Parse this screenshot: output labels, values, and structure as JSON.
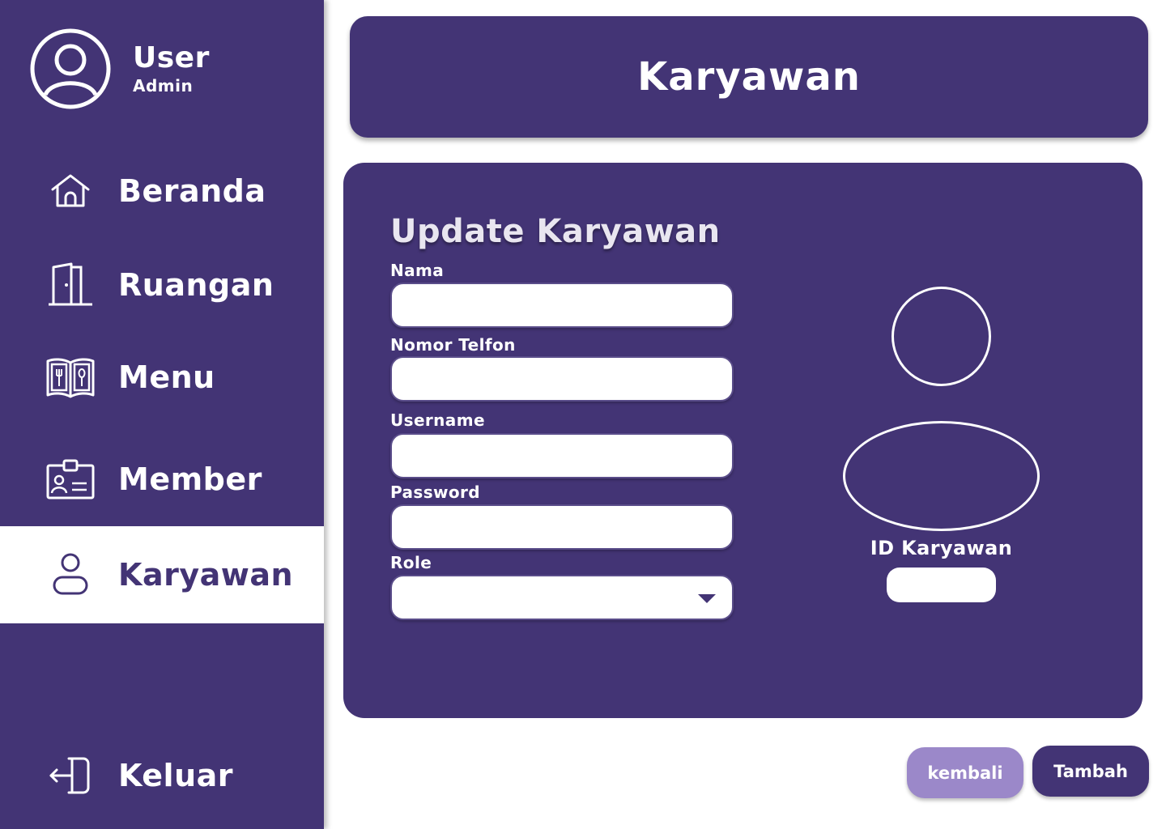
{
  "user": {
    "name": "User",
    "role": "Admin"
  },
  "sidebar": {
    "items": [
      {
        "label": "Beranda",
        "icon": "home-icon"
      },
      {
        "label": "Ruangan",
        "icon": "door-icon"
      },
      {
        "label": "Menu",
        "icon": "menu-book-icon"
      },
      {
        "label": "Member",
        "icon": "id-card-icon"
      },
      {
        "label": "Karyawan",
        "icon": "person-icon",
        "active": true
      },
      {
        "label": "Keluar",
        "icon": "logout-icon"
      }
    ]
  },
  "header": {
    "title": "Karyawan"
  },
  "form": {
    "title": "Update Karyawan",
    "fields": {
      "nama": {
        "label": "Nama",
        "value": ""
      },
      "telfon": {
        "label": "Nomor Telfon",
        "value": ""
      },
      "username": {
        "label": "Username",
        "value": ""
      },
      "password": {
        "label": "Password",
        "value": ""
      },
      "role": {
        "label": "Role",
        "value": ""
      }
    },
    "id_label": "ID Karyawan",
    "id_value": ""
  },
  "buttons": {
    "back": "kembali",
    "add": "Tambah"
  },
  "colors": {
    "primary": "#433475",
    "secondary": "#9b88c9",
    "white": "#ffffff"
  }
}
